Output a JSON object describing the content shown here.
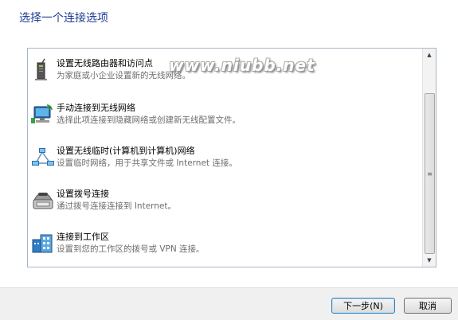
{
  "dialog": {
    "heading": "选择一个连接选项"
  },
  "watermark": "www.niubb.net",
  "options": [
    {
      "title": "设置无线路由器和访问点",
      "description": "为家庭或小企业设置新的无线网络。",
      "icon": "wireless-router-icon"
    },
    {
      "title": "手动连接到无线网络",
      "description": "选择此项连接到隐藏网络或创建新无线配置文件。",
      "icon": "wireless-network-computer-icon"
    },
    {
      "title": "设置无线临时(计算机到计算机)网络",
      "description": "设置临时网络，用于共享文件或 Internet 连接。",
      "icon": "adhoc-network-icon"
    },
    {
      "title": "设置拨号连接",
      "description": "通过拨号连接连接到 Internet。",
      "icon": "dialup-phone-icon"
    },
    {
      "title": "连接到工作区",
      "description": "设置到您的工作区的拨号或 VPN 连接。",
      "icon": "workplace-vpn-icon"
    }
  ],
  "buttons": {
    "next": "下一步(N)",
    "cancel": "取消"
  },
  "scrollbar": {
    "up_glyph": "▲",
    "down_glyph": "▼",
    "grip_glyph": "≡"
  }
}
